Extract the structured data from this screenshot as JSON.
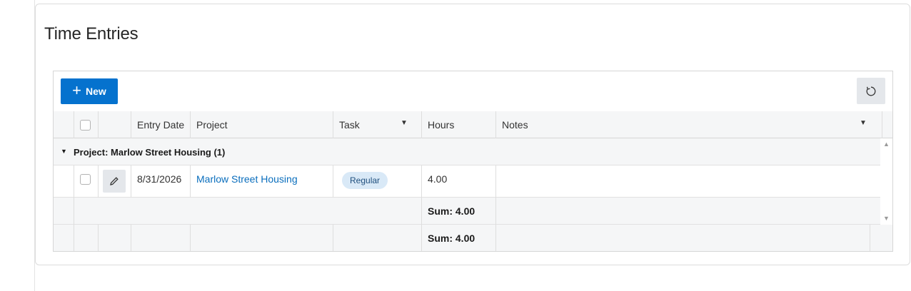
{
  "region": {
    "title": "Time Entries"
  },
  "toolbar": {
    "new_label": "New",
    "new_icon": "plus-icon",
    "refresh_icon": "refresh-icon"
  },
  "grid": {
    "columns": [
      "Entry Date",
      "Project",
      "Task",
      "Hours",
      "Notes"
    ],
    "filterable_columns": [
      "Task",
      "Notes"
    ],
    "group": {
      "label": "Project: Marlow Street Housing (1)"
    },
    "rows": [
      {
        "entry_date": "8/31/2026",
        "project": "Marlow Street Housing",
        "task": "Regular",
        "hours": "4.00",
        "notes": ""
      }
    ],
    "group_sum": "Sum: 4.00",
    "total_sum": "Sum: 4.00"
  },
  "colors": {
    "accent": "#0572ce",
    "badge_bg": "#d9e9f7",
    "link": "#0a6ebd"
  }
}
